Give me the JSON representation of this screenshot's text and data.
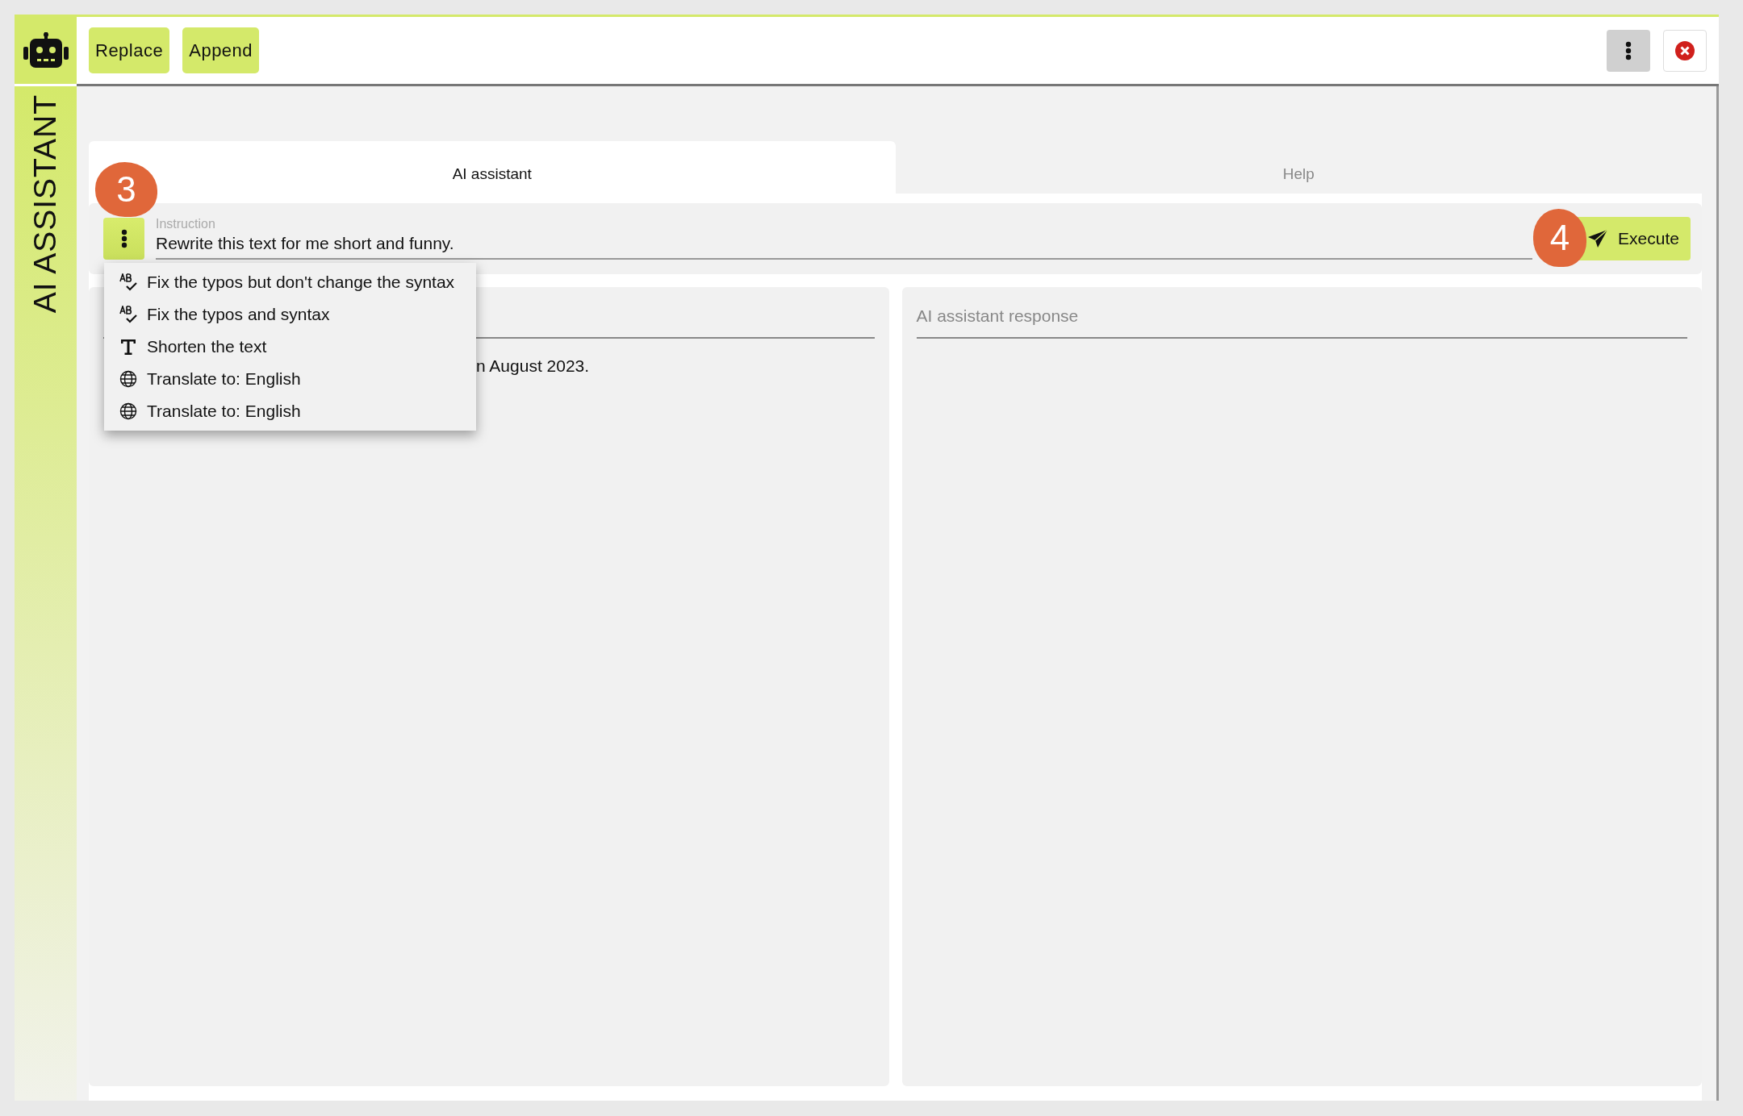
{
  "sidebar": {
    "title": "AI ASSISTANT"
  },
  "toolbar": {
    "buttons": [
      "Replace",
      "Append"
    ]
  },
  "tabs": [
    {
      "label": "AI assistant",
      "selected": true
    },
    {
      "label": "Help",
      "selected": false
    }
  ],
  "instruction": {
    "label": "Instruction",
    "value": "Rewrite this text for me short and funny."
  },
  "execute_button": "Execute",
  "callouts": [
    "3",
    "4"
  ],
  "menu": {
    "items": [
      {
        "kind": "spellcheck",
        "label": "Fix the typos but don't change the syntax"
      },
      {
        "kind": "spellcheck",
        "label": "Fix the typos and syntax"
      },
      {
        "kind": "text",
        "label": "Shorten the text"
      },
      {
        "kind": "globe",
        "label": "Translate to: English"
      },
      {
        "kind": "globe",
        "label": "Translate to: English"
      }
    ]
  },
  "source": {
    "text": "n August 2023."
  },
  "response": {
    "placeholder": "AI assistant response"
  }
}
